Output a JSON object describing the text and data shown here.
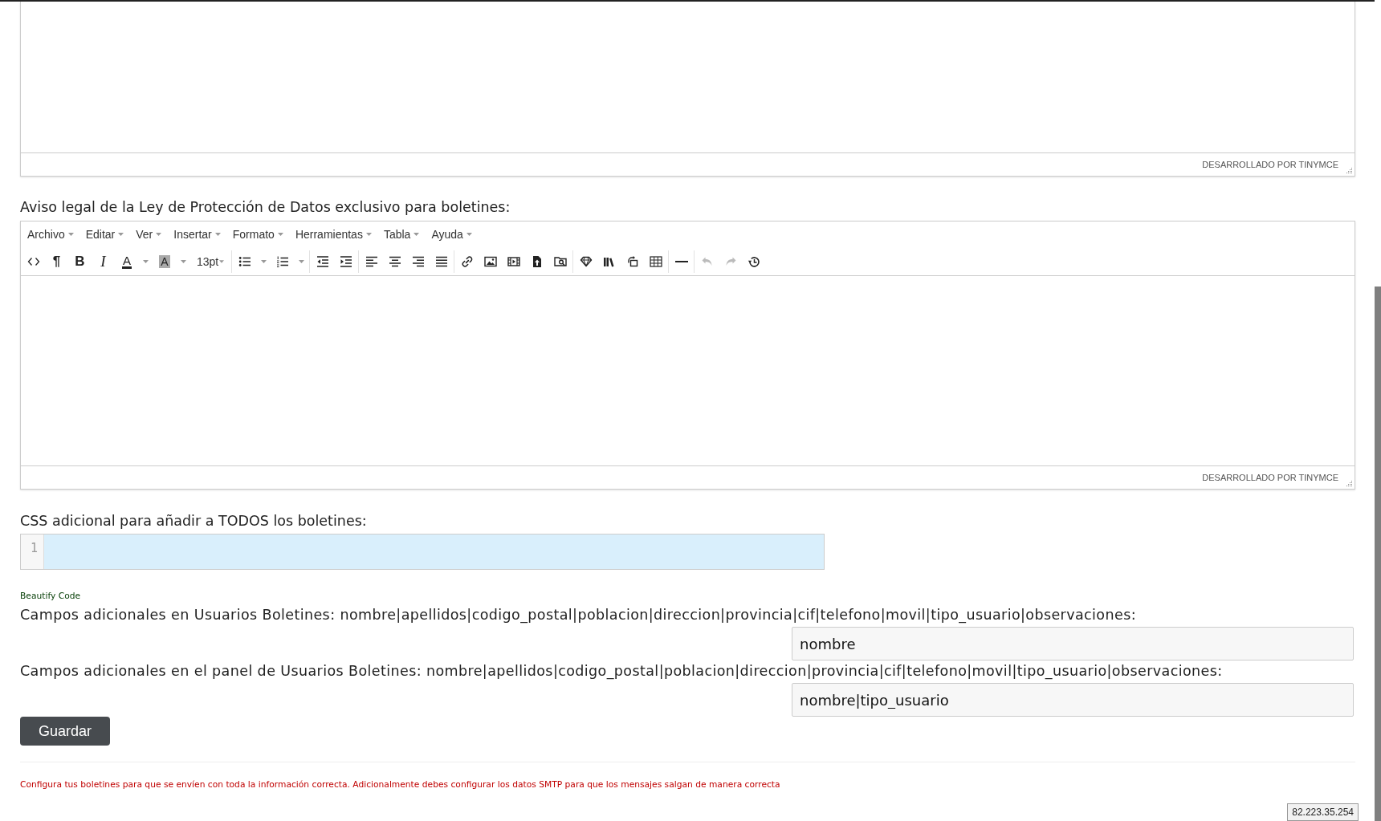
{
  "top_editor": {
    "status_bar": "DESARROLLADO POR TINYMCE"
  },
  "legal_notice_editor": {
    "label": "Aviso legal de la Ley de Protección de Datos exclusivo para boletines:",
    "menu": [
      "Archivo",
      "Editar",
      "Ver",
      "Insertar",
      "Formato",
      "Herramientas",
      "Tabla",
      "Ayuda"
    ],
    "toolbar": {
      "paragraph_mark": "¶",
      "bold": "B",
      "italic": "I",
      "text_color": "A",
      "background_color": "A",
      "font_size": "13pt",
      "undo": {
        "disabled": true
      },
      "redo": {
        "disabled": true
      }
    },
    "status_bar": "DESARROLLADO POR TINYMCE"
  },
  "css_editor": {
    "label": "CSS adicional para añadir a TODOS los boletines:",
    "line_numbers": [
      "1"
    ],
    "beautify_link": "Beautify Code"
  },
  "fields": [
    {
      "label": "Campos adicionales en Usuarios Boletines: nombre|apellidos|codigo_postal|poblacion|direccion|provincia|cif|telefono|movil|tipo_usuario|observaciones:",
      "value": "nombre"
    },
    {
      "label": "Campos adicionales en el panel de Usuarios Boletines: nombre|apellidos|codigo_postal|poblacion|direccion|provincia|cif|telefono|movil|tipo_usuario|observaciones:",
      "value": "nombre|tipo_usuario"
    }
  ],
  "save_button": "Guardar",
  "notice": "Configura tus boletines para que se envíen con toda la información correcta. Adicionalmente debes configurar los datos SMTP para que los mensajes salgan de manera correcta",
  "ip_badge": "82.223.35.254"
}
